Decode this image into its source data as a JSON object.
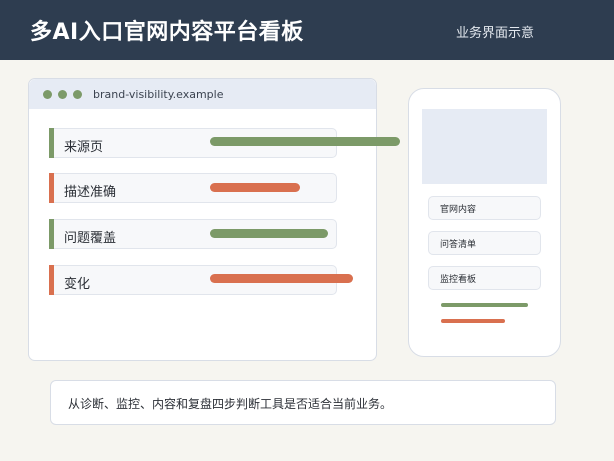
{
  "header": {
    "title": "多AI入口官网内容平台看板",
    "note": "业务界面示意"
  },
  "browser": {
    "url": "brand-visibility.example",
    "rows": [
      {
        "label": "来源页",
        "accent": "#7c9a68",
        "bar_color": "#7c9a68",
        "value": 0.97
      },
      {
        "label": "描述准确",
        "accent": "#d9704f",
        "bar_color": "#d9704f",
        "value": 0.46
      },
      {
        "label": "问题覆盖",
        "accent": "#7c9a68",
        "bar_color": "#7c9a68",
        "value": 0.6
      },
      {
        "label": "变化",
        "accent": "#d9704f",
        "bar_color": "#d9704f",
        "value": 0.73
      }
    ]
  },
  "phone": {
    "items": [
      "官网内容",
      "问答清单",
      "监控看板"
    ],
    "lines": [
      {
        "color": "#7c9a68",
        "value": 1.0
      },
      {
        "color": "#d9704f",
        "value": 0.74
      }
    ]
  },
  "caption": "从诊断、监控、内容和复盘四步判断工具是否适合当前业务。",
  "colors": {
    "header_bg": "#2e3d50",
    "green": "#7c9a68",
    "orange": "#d9704f",
    "page_bg": "#f6f5f0"
  }
}
